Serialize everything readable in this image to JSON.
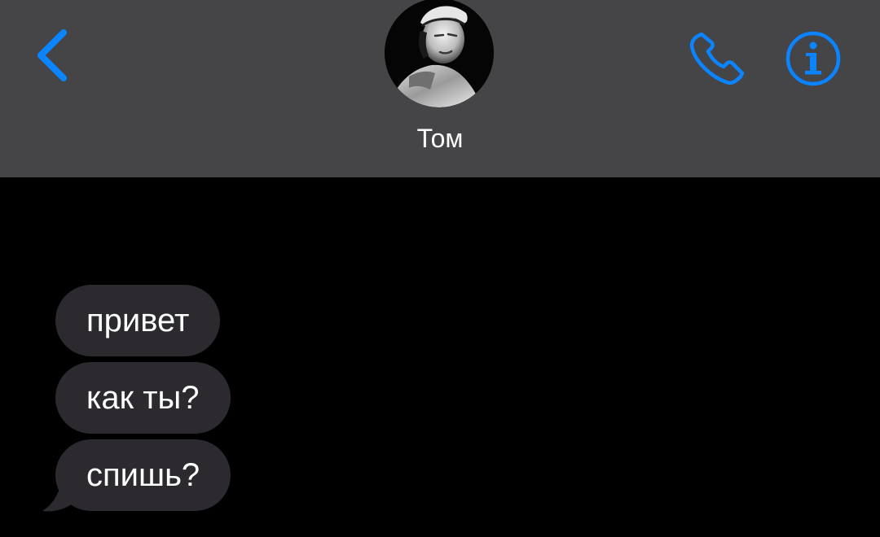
{
  "header": {
    "contact_name": "Том",
    "accent_color": "#0a84ff",
    "icons": [
      "chevron-left-icon",
      "phone-icon",
      "info-icon"
    ]
  },
  "messages": [
    {
      "text": "привет",
      "direction": "incoming"
    },
    {
      "text": "как ты?",
      "direction": "incoming"
    },
    {
      "text": "спишь?",
      "direction": "incoming"
    }
  ],
  "colors": {
    "header_bg": "#454447",
    "thread_bg": "#000000",
    "bubble_bg": "#2c2a2f",
    "text": "#ffffff"
  }
}
